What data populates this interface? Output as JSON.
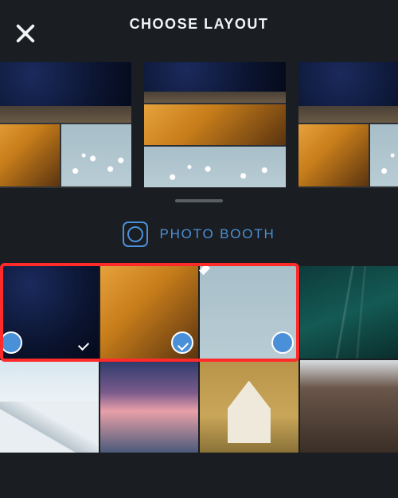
{
  "header": {
    "title": "CHOOSE LAYOUT",
    "close_icon": "close-icon"
  },
  "layouts": [
    {
      "id": "layout-a",
      "pattern": "top1-bottom2",
      "thumbs": [
        "night",
        "rock",
        "blossom"
      ]
    },
    {
      "id": "layout-b",
      "pattern": "rows3",
      "thumbs": [
        "night",
        "rock",
        "blossom"
      ]
    },
    {
      "id": "layout-c",
      "pattern": "top1-bottom2",
      "thumbs": [
        "night",
        "rock",
        "blossom"
      ]
    }
  ],
  "photo_booth": {
    "label": "PHOTO BOOTH",
    "icon": "camera-icon"
  },
  "gallery": {
    "rows": [
      [
        {
          "name": "night",
          "selected": true
        },
        {
          "name": "rock",
          "selected": true
        },
        {
          "name": "blossom",
          "selected": true
        },
        {
          "name": "ocean",
          "selected": false
        }
      ],
      [
        {
          "name": "snow",
          "selected": false
        },
        {
          "name": "pink",
          "selected": false
        },
        {
          "name": "house",
          "selected": false
        },
        {
          "name": "cliff",
          "selected": false
        }
      ]
    ],
    "highlight_box": {
      "covers_first_n": 3
    }
  },
  "colors": {
    "accent": "#4a90d9",
    "highlight": "#ff2a2a",
    "bg": "#1a1d21"
  }
}
